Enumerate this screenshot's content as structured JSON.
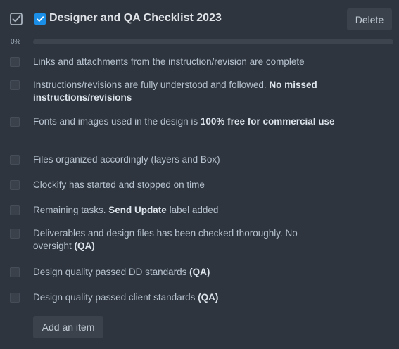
{
  "checklist": {
    "title": "Designer and QA Checklist 2023",
    "delete_label": "Delete",
    "progress_text": "0%",
    "progress_value": 0,
    "add_item_label": "Add an item",
    "items": [
      {
        "parts": [
          {
            "text": "Links and attachments from the instruction/revision are complete",
            "bold": false
          }
        ]
      },
      {
        "parts": [
          {
            "text": "Instructions/revisions are fully understood and followed. ",
            "bold": false
          },
          {
            "text": "No missed instructions/revisions",
            "bold": true
          }
        ]
      },
      {
        "parts": [
          {
            "text": "Fonts and images used in the design is ",
            "bold": false
          },
          {
            "text": "100% free for commercial use",
            "bold": true
          }
        ]
      },
      {
        "parts": [
          {
            "text": "Files organized accordingly (layers and Box)",
            "bold": false
          }
        ]
      },
      {
        "parts": [
          {
            "text": "Clockify has started and stopped on time",
            "bold": false
          }
        ]
      },
      {
        "parts": [
          {
            "text": "Remaining tasks. ",
            "bold": false
          },
          {
            "text": "Send Update",
            "bold": true
          },
          {
            "text": " label added",
            "bold": false
          }
        ]
      },
      {
        "parts": [
          {
            "text": "Deliverables and design files has been checked thoroughly. No oversight ",
            "bold": false
          },
          {
            "text": "(QA)",
            "bold": true
          }
        ]
      },
      {
        "parts": [
          {
            "text": "Design quality passed DD standards ",
            "bold": false
          },
          {
            "text": "(QA)",
            "bold": true
          }
        ]
      },
      {
        "parts": [
          {
            "text": "Design quality passed client standards ",
            "bold": false
          },
          {
            "text": "(QA)",
            "bold": true
          }
        ]
      }
    ]
  },
  "icons": {
    "header": "checklist-icon",
    "title_checkbox": "checkbox-checked-icon"
  },
  "colors": {
    "background": "#2f353e",
    "checkbox_accent": "#1b8fe8",
    "button_bg": "#3b424c"
  }
}
